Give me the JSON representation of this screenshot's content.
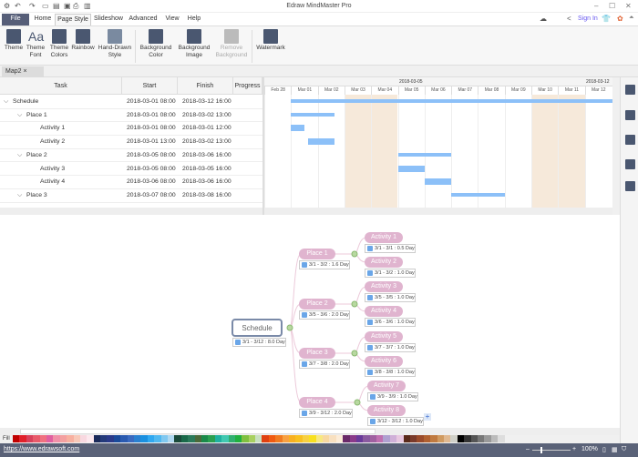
{
  "app": {
    "title": "Edraw MindMaster Pro",
    "sign_in": "Sign In"
  },
  "menu_tabs": [
    "File",
    "Home",
    "Page Style",
    "Slideshow",
    "Advanced",
    "View",
    "Help"
  ],
  "ribbon": [
    {
      "label": "Theme"
    },
    {
      "label": "Theme Font"
    },
    {
      "label": "Theme Colors"
    },
    {
      "label": "Rainbow"
    },
    {
      "label": "Hand-Drawn Style"
    },
    {
      "label": "Background Color"
    },
    {
      "label": "Background Image"
    },
    {
      "label": "Remove Background",
      "disabled": true
    },
    {
      "label": "Watermark"
    }
  ],
  "doc_tab": "Map2",
  "gantt": {
    "headers": {
      "task": "Task",
      "start": "Start",
      "finish": "Finish",
      "progress": "Progress"
    },
    "top_dates": [
      "2018-03-05",
      "2018-03-12"
    ],
    "days": [
      "Feb 28",
      "Mar 01",
      "Mar 02",
      "Mar 03",
      "Mar 04",
      "Mar 05",
      "Mar 06",
      "Mar 07",
      "Mar 08",
      "Mar 09",
      "Mar 10",
      "Mar 11",
      "Mar 12"
    ],
    "weekend_days": [
      "Mar 03",
      "Mar 04",
      "Mar 10",
      "Mar 11"
    ],
    "rows": [
      {
        "task": "Schedule",
        "level": 0,
        "summary": true,
        "start": "2018-03-01 08:00",
        "finish": "2018-03-12 16:00",
        "s": [
          1,
          8
        ],
        "f": [
          12,
          16
        ]
      },
      {
        "task": "Place 1",
        "level": 1,
        "summary": true,
        "start": "2018-03-01 08:00",
        "finish": "2018-03-02 13:00",
        "s": [
          1,
          8
        ],
        "f": [
          2,
          13
        ]
      },
      {
        "task": "Activity 1",
        "level": 2,
        "start": "2018-03-01 08:00",
        "finish": "2018-03-01 12:00",
        "s": [
          1,
          8
        ],
        "f": [
          1,
          12
        ]
      },
      {
        "task": "Activity 2",
        "level": 2,
        "start": "2018-03-01 13:00",
        "finish": "2018-03-02 13:00",
        "s": [
          1,
          13
        ],
        "f": [
          2,
          13
        ]
      },
      {
        "task": "Place 2",
        "level": 1,
        "summary": true,
        "start": "2018-03-05 08:00",
        "finish": "2018-03-06 16:00",
        "s": [
          5,
          8
        ],
        "f": [
          6,
          16
        ]
      },
      {
        "task": "Activity 3",
        "level": 2,
        "start": "2018-03-05 08:00",
        "finish": "2018-03-05 16:00",
        "s": [
          5,
          8
        ],
        "f": [
          5,
          16
        ]
      },
      {
        "task": "Activity 4",
        "level": 2,
        "start": "2018-03-06 08:00",
        "finish": "2018-03-06 16:00",
        "s": [
          6,
          8
        ],
        "f": [
          6,
          16
        ]
      },
      {
        "task": "Place 3",
        "level": 1,
        "summary": true,
        "start": "2018-03-07 08:00",
        "finish": "2018-03-08 16:00",
        "s": [
          7,
          8
        ],
        "f": [
          8,
          16
        ]
      }
    ]
  },
  "mindmap": {
    "root": {
      "label": "Schedule",
      "date": "3/1 - 3/12 : 8.0 Day"
    },
    "places": [
      {
        "label": "Place 1",
        "date": "3/1 - 3/2 : 1.6 Day",
        "children": [
          {
            "label": "Activity 1",
            "date": "3/1 - 3/1 : 0.5 Day"
          },
          {
            "label": "Activity 2",
            "date": "3/1 - 3/2 : 1.0 Day"
          }
        ]
      },
      {
        "label": "Place 2",
        "date": "3/5 - 3/6 : 2.0 Day",
        "children": [
          {
            "label": "Activity 3",
            "date": "3/5 - 3/5 : 1.0 Day"
          },
          {
            "label": "Activity 4",
            "date": "3/6 - 3/6 : 1.0 Day"
          }
        ]
      },
      {
        "label": "Place 3",
        "date": "3/7 - 3/8 : 2.0 Day",
        "children": [
          {
            "label": "Activity 5",
            "date": "3/7 - 3/7 : 1.0 Day"
          },
          {
            "label": "Activity 6",
            "date": "3/8 - 3/8 : 1.0 Day"
          }
        ]
      },
      {
        "label": "Place 4",
        "date": "3/9 - 3/12 : 2.0 Day",
        "children": [
          {
            "label": "Activity 7",
            "date": "3/9 - 3/9 : 1.0 Day"
          },
          {
            "label": "Activity 8",
            "date": "3/12 - 3/12 : 1.0 Day"
          }
        ]
      }
    ]
  },
  "palette_label": "Fill",
  "palette": [
    "#c00000",
    "#e0202a",
    "#d8405a",
    "#e85a6a",
    "#f07080",
    "#e060a0",
    "#f090a8",
    "#f4a0a0",
    "#f8b0a0",
    "#f8c8b8",
    "#f8d8e0",
    "#fce8ee",
    "#1a2a5a",
    "#243a7a",
    "#2a3a8a",
    "#1a4a9a",
    "#2a5ab0",
    "#3a6ac0",
    "#2a80d0",
    "#1a90e0",
    "#30a8f0",
    "#50b8f0",
    "#80c8f0",
    "#b0d8f0",
    "#1a4a3a",
    "#1a6a4a",
    "#2a7a5a",
    "#4a6a3a",
    "#1a8a4a",
    "#2aa050",
    "#20b0a0",
    "#40c8b0",
    "#30b070",
    "#20b040",
    "#80c040",
    "#a8d060",
    "#c8e0c0",
    "#e04010",
    "#f05a10",
    "#f07a20",
    "#f8a040",
    "#f8b020",
    "#f8c020",
    "#f8d040",
    "#f8e020",
    "#f8e880",
    "#f8d8a0",
    "#f8e0c0",
    "#fcecd8",
    "#6a2a6a",
    "#8a3a8a",
    "#6a3a9a",
    "#8a5aa0",
    "#a060a0",
    "#c070b0",
    "#b0a0d0",
    "#d0b0d8",
    "#e8c8e0",
    "#5a2a1a",
    "#7a3a2a",
    "#9a4a2a",
    "#b06030",
    "#c07a40",
    "#d09a60",
    "#e0b890",
    "#d0d0c8",
    "#000000",
    "#333333",
    "#555555",
    "#777777",
    "#999999",
    "#bbbbbb",
    "#dddddd"
  ],
  "status": {
    "url": "https://www.edrawsoft.com",
    "zoom": "100%"
  }
}
